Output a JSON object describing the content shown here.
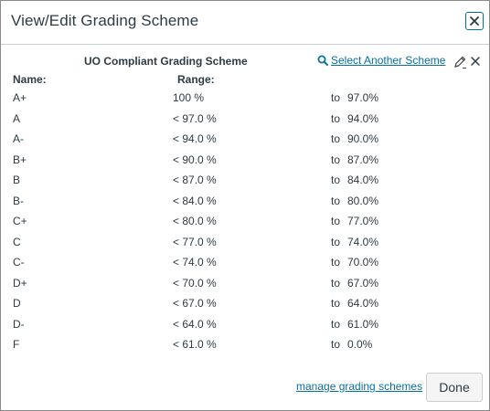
{
  "dialog": {
    "title": "View/Edit Grading Scheme",
    "close_label": "×"
  },
  "scheme": {
    "name": "UO Compliant Grading Scheme",
    "select_another_label": "Select Another Scheme",
    "remove_label": "×"
  },
  "columns": {
    "name": "Name:",
    "range": "Range:"
  },
  "rows": [
    {
      "name": "A+",
      "range": "100 %",
      "to": "to",
      "min": "97.0%"
    },
    {
      "name": "A",
      "range": "< 97.0 %",
      "to": "to",
      "min": "94.0%"
    },
    {
      "name": "A-",
      "range": "< 94.0 %",
      "to": "to",
      "min": "90.0%"
    },
    {
      "name": "B+",
      "range": "< 90.0 %",
      "to": "to",
      "min": "87.0%"
    },
    {
      "name": "B",
      "range": "< 87.0 %",
      "to": "to",
      "min": "84.0%"
    },
    {
      "name": "B-",
      "range": "< 84.0 %",
      "to": "to",
      "min": "80.0%"
    },
    {
      "name": "C+",
      "range": "< 80.0 %",
      "to": "to",
      "min": "77.0%"
    },
    {
      "name": "C",
      "range": "< 77.0 %",
      "to": "to",
      "min": "74.0%"
    },
    {
      "name": "C-",
      "range": "< 74.0 %",
      "to": "to",
      "min": "70.0%"
    },
    {
      "name": "D+",
      "range": "< 70.0 %",
      "to": "to",
      "min": "67.0%"
    },
    {
      "name": "D",
      "range": "< 67.0 %",
      "to": "to",
      "min": "64.0%"
    },
    {
      "name": "D-",
      "range": "< 64.0 %",
      "to": "to",
      "min": "61.0%"
    },
    {
      "name": "F",
      "range": "< 61.0 %",
      "to": "to",
      "min": "0.0%"
    }
  ],
  "footer": {
    "manage_label": "manage grading schemes",
    "done_label": "Done"
  },
  "icons": {
    "close": "close-icon",
    "search": "search-icon",
    "edit": "pencil-icon",
    "remove": "close-icon"
  },
  "colors": {
    "link": "#0770a3",
    "text": "#2d3b45"
  }
}
